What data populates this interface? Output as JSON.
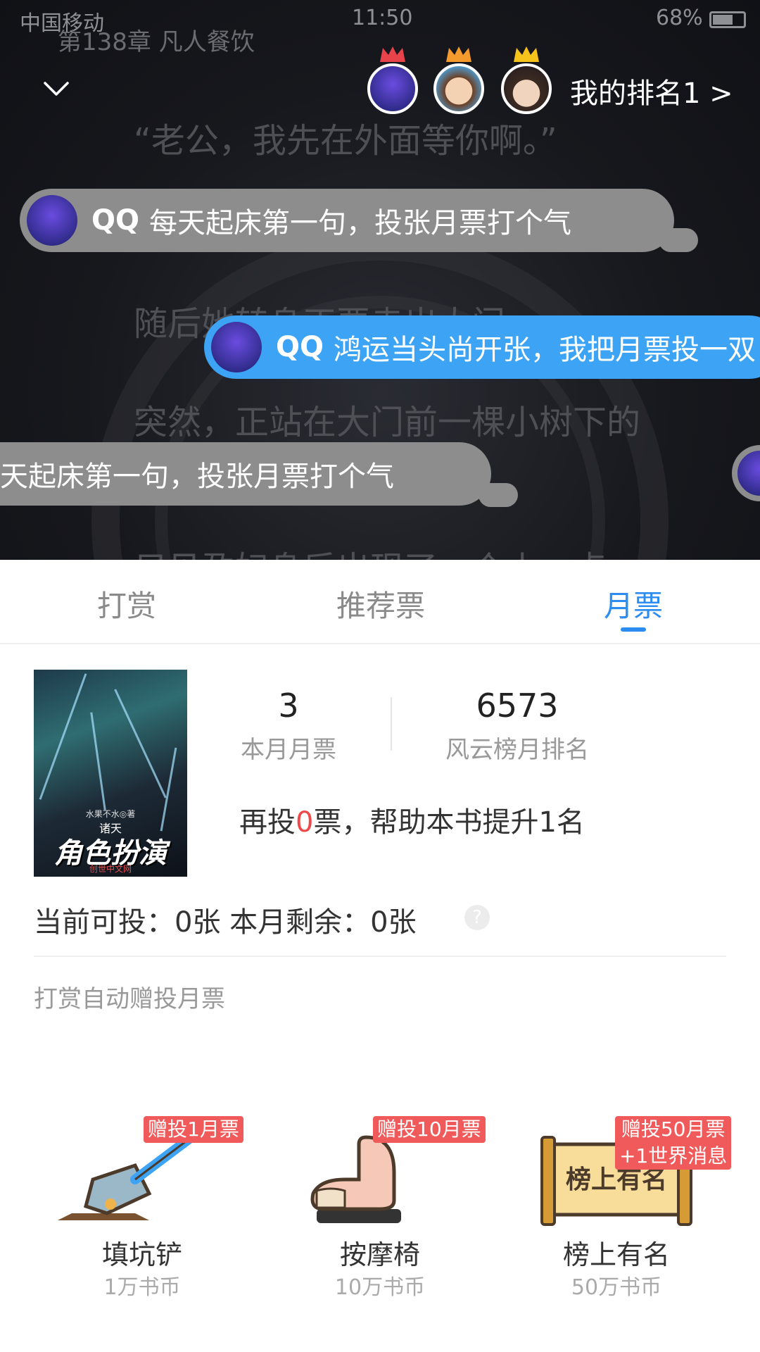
{
  "status_bar": {
    "carrier": "中国移动",
    "time": "11:50",
    "battery": "68%"
  },
  "reader": {
    "chapter_title": "第138章 凡人餐饮",
    "lines": [
      "“老公，我先在外面等你啊。”",
      "随后她转身正要走出大门",
      "突然，正站在大门前一棵小树下的",
      "只见孕妇身后出现了一个小一点"
    ],
    "my_rank_label": "我的排名1 >"
  },
  "danmaku": [
    {
      "user": "QQ",
      "text": "每天起床第一句，投张月票打个气",
      "color": "#8d8d8d"
    },
    {
      "user": "QQ",
      "text": "鸿运当头尚开张，我把月票投一双",
      "color": "#3da3f5"
    },
    {
      "user": "",
      "text": "天起床第一句，投张月票打个气",
      "color": "#8d8d8d"
    }
  ],
  "tabs": [
    {
      "label": "打赏",
      "active": false
    },
    {
      "label": "推荐票",
      "active": false
    },
    {
      "label": "月票",
      "active": true
    }
  ],
  "book": {
    "cover_author": "水果不水◎著",
    "cover_series": "诸天",
    "cover_title": "角色扮演",
    "cover_publisher": "创世中文网"
  },
  "stats": {
    "monthly_votes": "3",
    "monthly_votes_label": "本月月票",
    "rank": "6573",
    "rank_label": "风云榜月排名"
  },
  "boost": {
    "prefix": "再投",
    "count": "0",
    "suffix": "票，帮助本书提升1名"
  },
  "availability": {
    "text": "当前可投：0张    本月剩余：0张",
    "help_icon": "?"
  },
  "auto_note": "打赏自动赠投月票",
  "gifts": [
    {
      "name": "填坑铲",
      "price": "1万书币",
      "badge": "赠投1月票",
      "icon": "shovel-icon"
    },
    {
      "name": "按摩椅",
      "price": "10万书币",
      "badge": "赠投10月票",
      "icon": "massage-chair-icon"
    },
    {
      "name": "榜上有名",
      "price": "50万书币",
      "badge": "赠投50月票",
      "badge_line2": "+1世界消息",
      "icon": "scroll-icon",
      "scroll_text": "榜上有名"
    }
  ]
}
